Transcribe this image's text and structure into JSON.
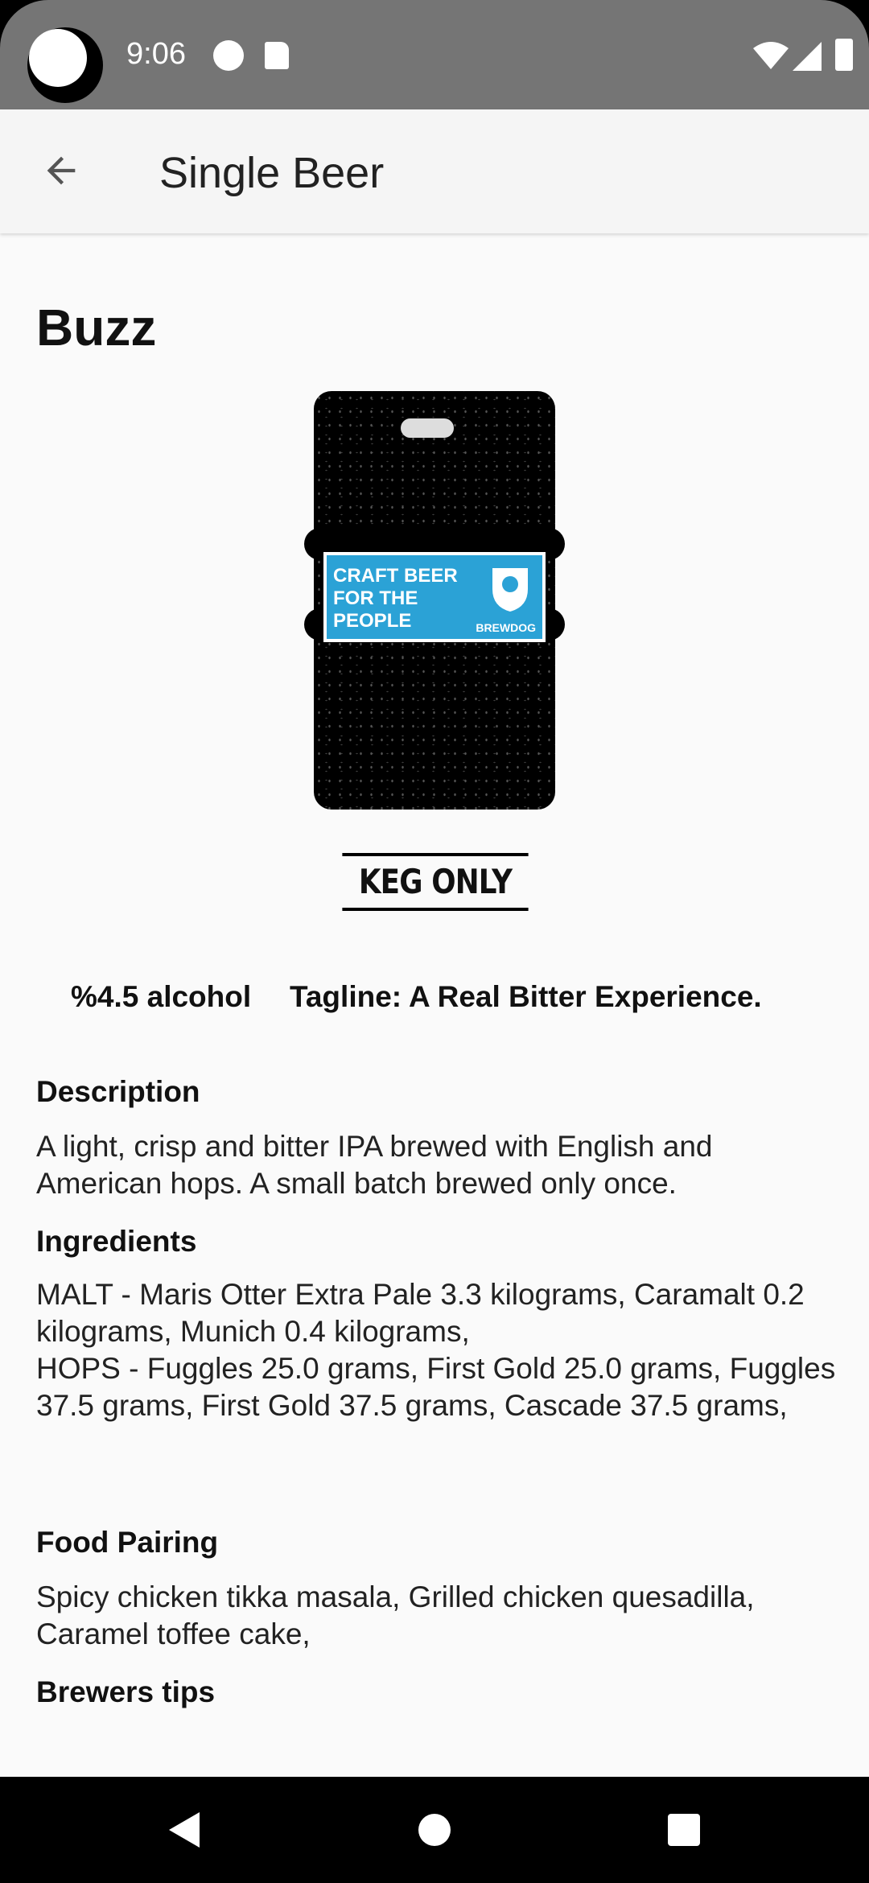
{
  "status_bar": {
    "time": "9:06",
    "icons": [
      "app-notification-icon",
      "sd-card-icon",
      "wifi-icon",
      "signal-icon",
      "battery-icon"
    ]
  },
  "app_bar": {
    "title": "Single Beer",
    "back_icon": "arrow-back-icon"
  },
  "beer": {
    "name": "Buzz",
    "image": {
      "label_text": "CRAFT BEER FOR THE PEOPLE",
      "brand": "BREWDOG",
      "keg_text": "KEG ONLY",
      "label_color": "#2ba2d6"
    },
    "alcohol": "%4.5 alcohol",
    "tagline": "Tagline: A Real Bitter Experience."
  },
  "sections": {
    "description_title": "Description",
    "description_body": "A light, crisp and bitter IPA brewed with English and American hops. A small batch brewed only once.",
    "ingredients_title": "Ingredients",
    "ingredients_malt": "MALT - Maris Otter Extra Pale 3.3 kilograms, Caramalt 0.2 kilograms, Munich 0.4 kilograms,",
    "ingredients_hops": "HOPS - Fuggles 25.0 grams, First Gold 25.0 grams, Fuggles 37.5 grams, First Gold 37.5 grams, Cascade 37.5 grams,",
    "food_pairing_title": "Food Pairing",
    "food_pairing_body": "Spicy chicken tikka masala, Grilled chicken quesadilla, Caramel toffee cake,",
    "brewers_tips_title": "Brewers tips"
  },
  "nav_bar": {
    "buttons": [
      "back-nav-icon",
      "home-nav-icon",
      "recents-nav-icon"
    ]
  }
}
